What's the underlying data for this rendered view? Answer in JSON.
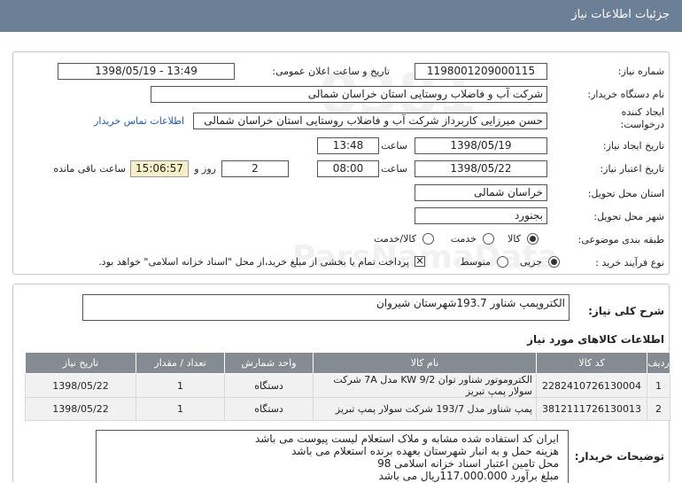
{
  "header": {
    "title": "جزئیات اطلاعات نیاز"
  },
  "form": {
    "need_number_label": "شماره نیاز:",
    "need_number": "1198001209000115",
    "announce_label": "تاریخ و ساعت اعلان عمومی:",
    "announce_value": "1398/05/19 - 13:49",
    "buyer_label": "نام دستگاه خریدار:",
    "buyer_value": "شرکت آب و فاضلاب روستایی استان خراسان شمالی",
    "creator_label": "ایجاد کننده درخواست:",
    "creator_value": "حسن  میرزایی کاربرداز شرکت آب و فاضلاب روستایی استان خراسان شمالی",
    "contact_link": "اطلاعات تماس خریدار",
    "create_date_label": "تاریخ ایجاد نیاز:",
    "create_date": "1398/05/19",
    "time_label": "ساعت",
    "create_time": "13:48",
    "valid_date_label": "تاریخ اعتبار نیاز:",
    "valid_date": "1398/05/22",
    "valid_time": "08:00",
    "days_value": "2",
    "days_label": "روز و",
    "remaining_value": "15:06:57",
    "remaining_label": "ساعت باقی مانده",
    "province_label": "استان محل تحویل:",
    "province_value": "خراسان شمالی",
    "city_label": "شهر محل تحویل:",
    "city_value": "بجنورد",
    "category_label": "طبقه بندی موضوعی:",
    "category_options": [
      "کالا",
      "خدمت",
      "کالا/خدمت"
    ],
    "purchase_label": "نوع فرآیند خرید :",
    "purchase_options": [
      "جزیی",
      "متوسط"
    ],
    "treasury_note": "پرداخت تمام یا بخشی از مبلغ خرید،از محل \"اسناد خزانه اسلامی\" خواهد بود."
  },
  "summary": {
    "label": "شرح کلی نیاز:",
    "value": "الکتروپمپ شناور 193.7شهرستان شیروان"
  },
  "items": {
    "title": "اطلاعات کالاهای مورد نیاز",
    "columns": [
      "ردیف",
      "کد کالا",
      "نام کالا",
      "واحد شمارش",
      "تعداد / مقدار",
      "تاریخ نیاز"
    ],
    "rows": [
      [
        "1",
        "2282410726130004",
        "الکتروموتور شناور توان KW 9/2 مدل 7A شرکت سولار پمپ تبریز",
        "دستگاه",
        "1",
        "1398/05/22"
      ],
      [
        "2",
        "3812111726130013",
        "پمپ شناور مدل 193/7 شرکت سولار پمپ تبریز",
        "دستگاه",
        "1",
        "1398/05/22"
      ]
    ]
  },
  "notes": {
    "label": "توضیحات خریدار:",
    "lines": [
      "ایران کد استفاده شده مشابه و ملاک استعلام لیست پیوست می باشد",
      "هزینه حمل و به انبار شهرستان  بعهده برنده استعلام می باشد",
      "محل تامین اعتبار اسناد خزانه اسلامی 98",
      "مبلغ برآورد 117.000.000ریال می باشد"
    ]
  }
}
